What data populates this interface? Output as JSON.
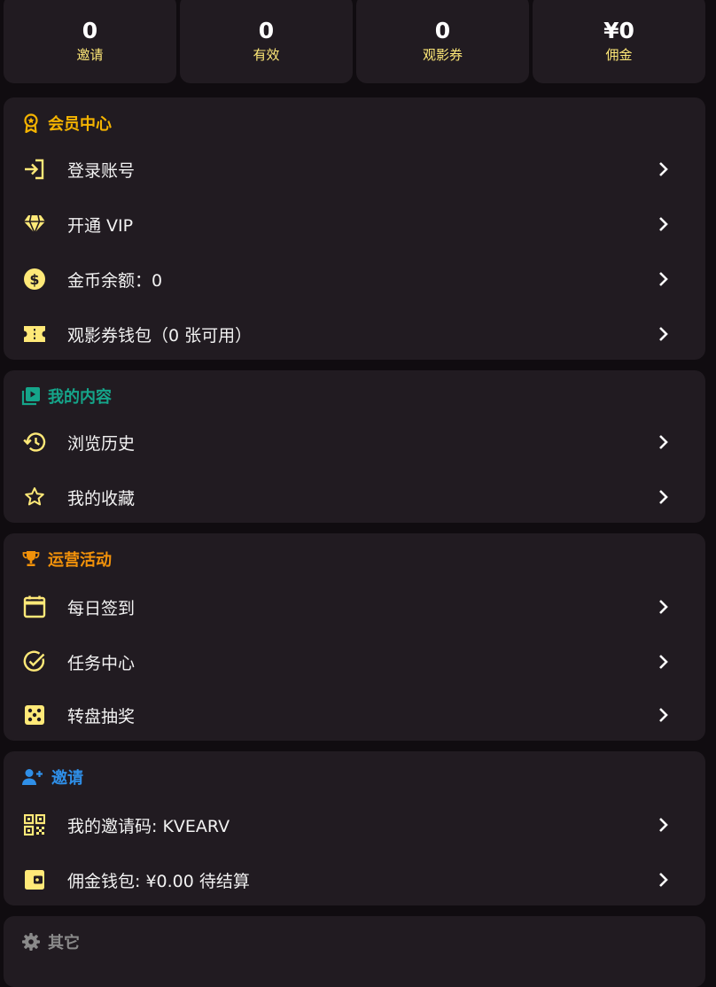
{
  "colors": {
    "background": "#100c10",
    "card": "#211b21",
    "yellow": "#ffe978",
    "gold": "#f5b400",
    "teal": "#15a58a",
    "orange": "#f2920a",
    "blue": "#2f8fe8",
    "gray": "#8a8a8a"
  },
  "stats": [
    {
      "value": "0",
      "label": "邀请"
    },
    {
      "value": "0",
      "label": "有效"
    },
    {
      "value": "0",
      "label": "观影券"
    },
    {
      "value": "¥0",
      "label": "佣金"
    }
  ],
  "member": {
    "title": "会员中心",
    "icon": "award-badge-icon",
    "items": [
      {
        "label": "登录账号",
        "icon": "login-icon"
      },
      {
        "label": "开通 VIP",
        "icon": "diamond-icon"
      },
      {
        "label": "金币余额：0",
        "icon": "coin-icon"
      },
      {
        "label": "观影券钱包（0 张可用）",
        "icon": "ticket-icon"
      }
    ]
  },
  "content": {
    "title": "我的内容",
    "icon": "video-library-icon",
    "items": [
      {
        "label": "浏览历史",
        "icon": "history-icon"
      },
      {
        "label": "我的收藏",
        "icon": "star-icon"
      }
    ]
  },
  "activity": {
    "title": "运营活动",
    "icon": "trophy-icon",
    "items": [
      {
        "label": "每日签到",
        "icon": "calendar-icon"
      },
      {
        "label": "任务中心",
        "icon": "check-circle-icon"
      },
      {
        "label": "转盘抽奖",
        "icon": "dice-icon"
      }
    ]
  },
  "invite": {
    "title": "邀请",
    "icon": "add-user-icon",
    "items": [
      {
        "label": "我的邀请码: KVEARV",
        "icon": "qr-code-icon"
      },
      {
        "label": "佣金钱包: ¥0.00 待结算",
        "icon": "wallet-icon"
      }
    ]
  },
  "other": {
    "title": "其它",
    "icon": "gear-icon"
  }
}
